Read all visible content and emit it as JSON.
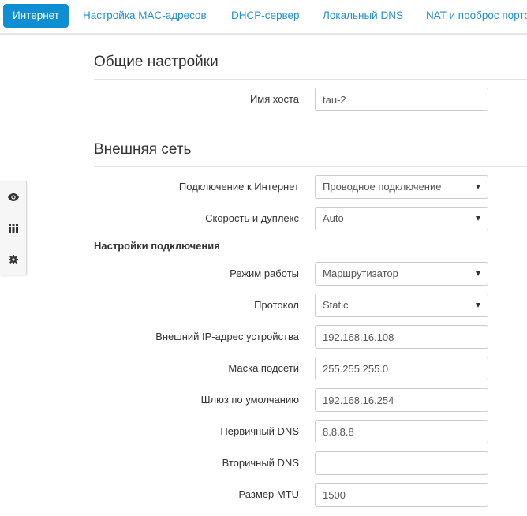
{
  "tabs": [
    {
      "label": "Интернет",
      "active": true
    },
    {
      "label": "Настройка MAC-адресов",
      "active": false
    },
    {
      "label": "DHCP-сервер",
      "active": false
    },
    {
      "label": "Локальный DNS",
      "active": false
    },
    {
      "label": "NAT и проброс портов",
      "active": false
    }
  ],
  "side_toolbar": {
    "icons": [
      "eye-icon",
      "grid-icon",
      "gear-icon"
    ]
  },
  "general": {
    "title": "Общие настройки",
    "hostname": {
      "label": "Имя хоста",
      "value": "tau-2"
    }
  },
  "wan": {
    "title": "Внешняя сеть",
    "connection_type": {
      "label": "Подключение к Интернет",
      "value": "Проводное подключение"
    },
    "speed_duplex": {
      "label": "Скорость и дуплекс",
      "value": "Auto"
    }
  },
  "connection_settings": {
    "title": "Настройки подключения",
    "mode": {
      "label": "Режим работы",
      "value": "Маршрутизатор"
    },
    "protocol": {
      "label": "Протокол",
      "value": "Static"
    },
    "ip": {
      "label": "Внешний IP-адрес устройства",
      "value": "192.168.16.108"
    },
    "mask": {
      "label": "Маска подсети",
      "value": "255.255.255.0"
    },
    "gateway": {
      "label": "Шлюз по умолчанию",
      "value": "192.168.16.254"
    },
    "dns1": {
      "label": "Первичный DNS",
      "value": "8.8.8.8"
    },
    "dns2": {
      "label": "Вторичный DNS",
      "value": ""
    },
    "mtu": {
      "label": "Размер MTU",
      "value": "1500"
    }
  },
  "colors": {
    "accent": "#0f8ed4",
    "link": "#1e8fd8"
  }
}
